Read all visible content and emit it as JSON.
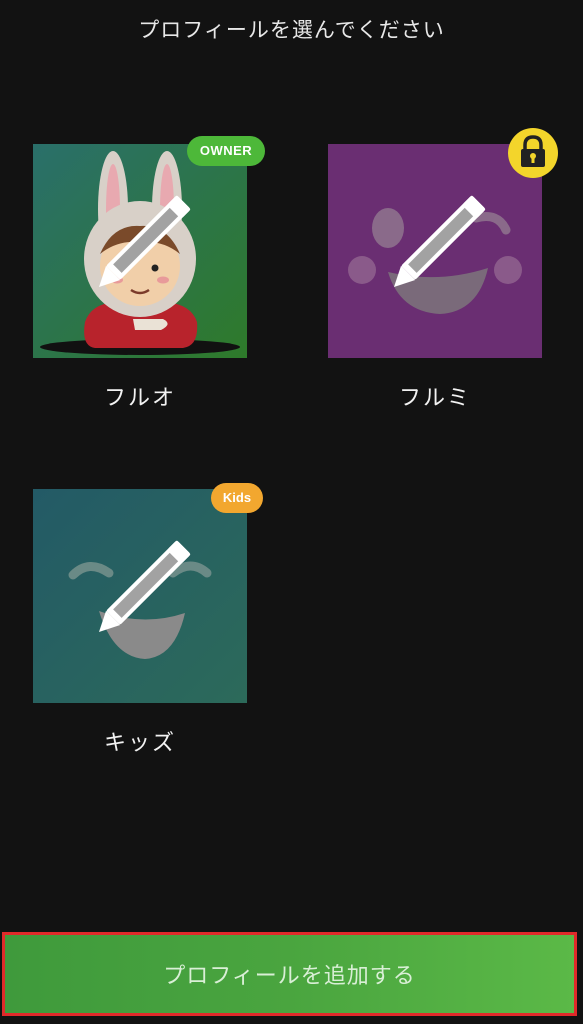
{
  "header": {
    "title": "プロフィールを選んでください"
  },
  "profiles": [
    {
      "name": "フルオ",
      "badge": "OWNER",
      "badge_color": "#4db839",
      "avatar": "rabbit-hood-character",
      "edit_icon": "pencil-icon"
    },
    {
      "name": "フルミ",
      "badge_icon": "lock-icon",
      "badge_color": "#f3d52b",
      "avatar": "smiley-face-purple",
      "edit_icon": "pencil-icon"
    },
    {
      "name": "キッズ",
      "badge": "Kids",
      "badge_color": "#f2a72f",
      "avatar": "laughing-face-teal",
      "edit_icon": "pencil-icon"
    }
  ],
  "footer": {
    "add_profile_label": "プロフィールを追加する",
    "button_color": "#4aa53f"
  }
}
